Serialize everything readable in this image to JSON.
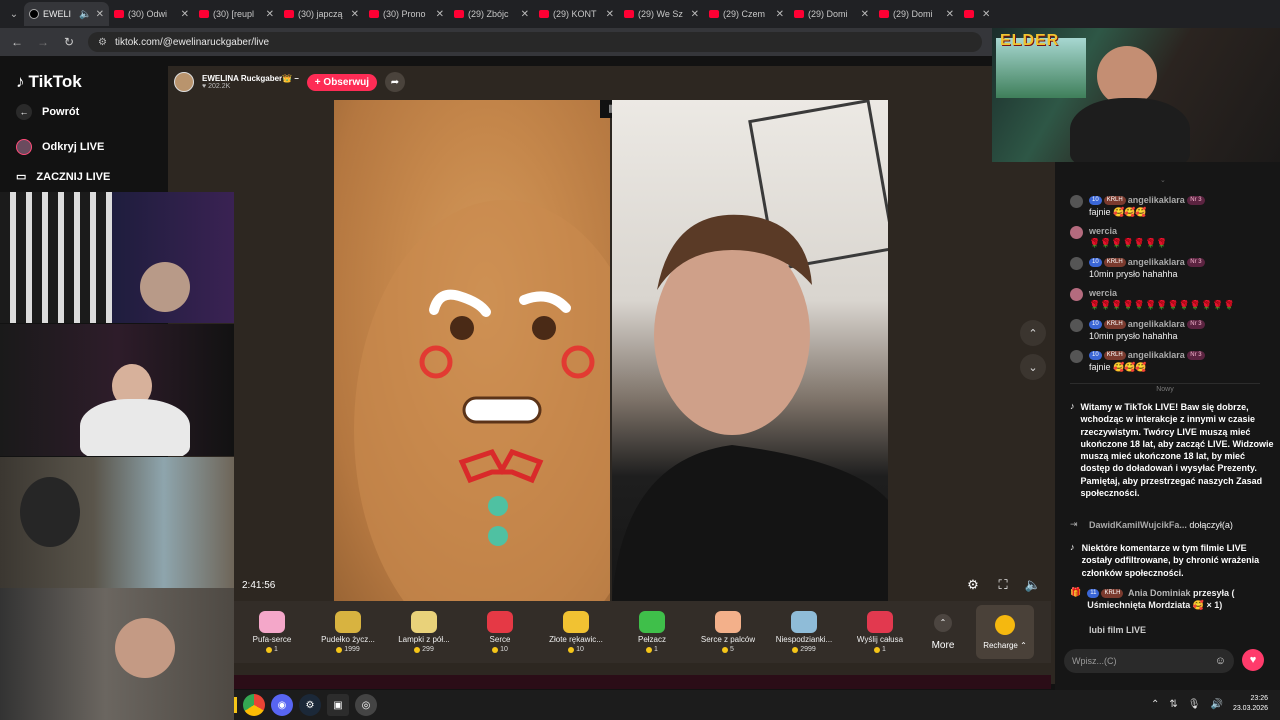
{
  "browser": {
    "tabs": [
      {
        "title": "EWELI",
        "kind": "tiktok",
        "active": true
      },
      {
        "title": "(30) Odwi",
        "kind": "youtube"
      },
      {
        "title": "(30) [reupl",
        "kind": "youtube"
      },
      {
        "title": "(30) japczą",
        "kind": "youtube"
      },
      {
        "title": "(30) Prono",
        "kind": "youtube"
      },
      {
        "title": "(29) Zbójc",
        "kind": "youtube"
      },
      {
        "title": "(29) KONT",
        "kind": "youtube"
      },
      {
        "title": "(29) We Sz",
        "kind": "youtube"
      },
      {
        "title": "(29) Czem",
        "kind": "youtube"
      },
      {
        "title": "(29) Domi",
        "kind": "youtube"
      },
      {
        "title": "(29) Domi",
        "kind": "youtube"
      },
      {
        "title": "Je",
        "kind": "youtube"
      }
    ],
    "url": "tiktok.com/@ewelinaruckgaber/live"
  },
  "sidebar": {
    "logo": "TikTok",
    "back": "Powrót",
    "discover": "Odkryj LIVE",
    "start": "ZACZNIJ LIVE"
  },
  "stream": {
    "host_name": "EWELINA Ruckgaber👑 –",
    "host_likes": "202.2K",
    "follow_label": "+ Obserwuj",
    "timer": "2:41:56"
  },
  "gifts": [
    {
      "name": "Pufa-serce",
      "price": "1",
      "color": "#f4a7c9"
    },
    {
      "name": "Pudełko życz...",
      "price": "1999",
      "color": "#d8b340"
    },
    {
      "name": "Lampki z pół...",
      "price": "299",
      "color": "#e9d27a"
    },
    {
      "name": "Serce",
      "price": "10",
      "color": "#e53945"
    },
    {
      "name": "Złote rękawic...",
      "price": "10",
      "color": "#f1c232"
    },
    {
      "name": "Pełzacz",
      "price": "1",
      "color": "#3fbf4a"
    },
    {
      "name": "Serce z palców",
      "price": "5",
      "color": "#f3b08a"
    },
    {
      "name": "Niespodzianki...",
      "price": "2999",
      "color": "#8fbcd8"
    },
    {
      "name": "Wyślij całusa",
      "price": "1",
      "color": "#e2394f"
    }
  ],
  "gift_more": "More",
  "recharge": "Recharge ⌃",
  "chat": {
    "messages": [
      {
        "user": "angelikaklara",
        "level": "10",
        "fan": "KRLH",
        "rank": "Nr 3",
        "text": "fajnie 🥰🥰🥰"
      },
      {
        "user": "wercia",
        "text": "🌹🌹🌹🌹🌹🌹🌹"
      },
      {
        "user": "angelikaklara",
        "level": "10",
        "fan": "KRLH",
        "rank": "Nr 3",
        "text": "10min prysło hahahha"
      },
      {
        "user": "wercia",
        "text": "🌹🌹🌹🌹🌹🌹🌹🌹🌹🌹🌹🌹🌹"
      },
      {
        "user": "angelikaklara",
        "level": "10",
        "fan": "KRLH",
        "rank": "Nr 3",
        "text": "10min prysło hahahha"
      },
      {
        "user": "angelikaklara",
        "level": "10",
        "fan": "KRLH",
        "rank": "Nr 3",
        "text": "fajnie 🥰🥰🥰"
      }
    ],
    "new_divider": "Nowy",
    "welcome": "Witamy w TikTok LIVE! Baw się dobrze, wchodząc w interakcje z innymi w czasie rzeczywistym. Twórcy LIVE muszą mieć ukończone 18 lat, aby zacząć LIVE. Widzowie muszą mieć ukończone 18 lat, by mieć dostęp do doładowań i wysyłać Prezenty. Pamiętaj, aby przestrzegać naszych Zasad społeczności.",
    "joined_user": "DawidKamilWujcikFa...",
    "joined_text": "dołączył(a)",
    "filtered": "Niektóre komentarze w tym filmie LIVE zostały odfiltrowane, by chronić wrażenia członków społeczności.",
    "gift_user": "Ania Dominiak",
    "gift_level": "11",
    "gift_fan": "KRLH",
    "gift_text": "przesyła ( Uśmiechnięta Mordziata 🥰 × 1)",
    "partial": "lubi film LIVE",
    "input_placeholder": "Wpisz...(C)"
  },
  "overlay": {
    "logo_text": "ELDER"
  },
  "taskbar": {
    "time": "23:26",
    "date": "23.03.2026"
  },
  "colors": {
    "accent": "#fe2c55",
    "coin": "#f5c518",
    "page_bg": "#121212"
  }
}
